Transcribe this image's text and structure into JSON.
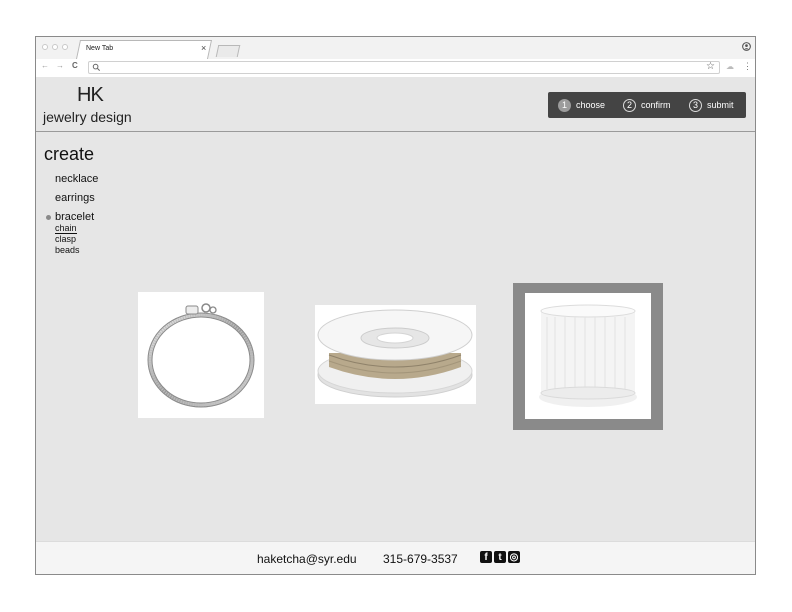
{
  "browser": {
    "tab_title": "New Tab",
    "tab_close": "×",
    "back": "←",
    "forward": "→",
    "reload": "C",
    "star": "☆",
    "extension": "☁",
    "menu": "⋮"
  },
  "logo": {
    "mark": "HK",
    "text": "jewelry design"
  },
  "steps": [
    {
      "num": "1",
      "label": "choose",
      "active": true
    },
    {
      "num": "2",
      "label": "confirm",
      "active": false
    },
    {
      "num": "3",
      "label": "submit",
      "active": false
    }
  ],
  "nav": {
    "heading": "create",
    "items": [
      "necklace",
      "earrings",
      "bracelet"
    ],
    "active_item": "bracelet",
    "subitems": [
      "chain",
      "clasp",
      "beads"
    ],
    "active_subitem": "chain"
  },
  "products": [
    {
      "icon": "snake-chain-bracelet-image",
      "selected": false
    },
    {
      "icon": "silver-wire-spool-image",
      "selected": false
    },
    {
      "icon": "clear-elastic-cord-spool-image",
      "selected": true
    }
  ],
  "footer": {
    "email": "haketcha@syr.edu",
    "phone": "315-679-3537",
    "social": [
      {
        "icon": "facebook-icon",
        "glyph": "f"
      },
      {
        "icon": "twitter-icon",
        "glyph": "t"
      },
      {
        "icon": "instagram-icon",
        "glyph": "◎"
      }
    ]
  },
  "colors": {
    "page_bg": "#e6e6e6",
    "stepbar_bg": "#444444",
    "selection_border": "#8a8a8a"
  }
}
